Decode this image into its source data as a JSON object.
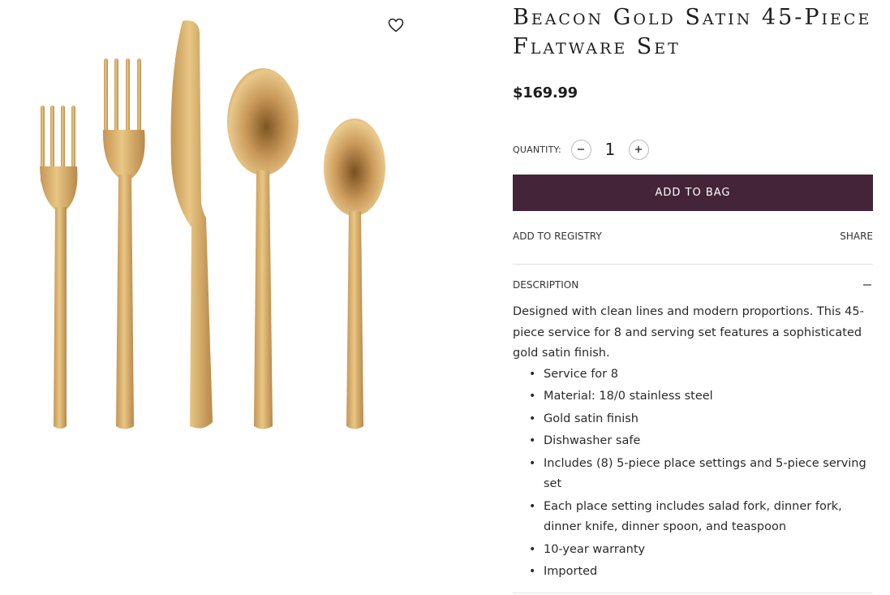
{
  "product": {
    "title": "Beacon Gold Satin 45-Piece Flatware Set",
    "price": "$169.99",
    "image_alt": "gold flatware set: salad fork, dinner fork, dinner knife, dinner spoon, teaspoon",
    "wishlist_icon": "heart-outline-icon",
    "colors": {
      "gold_light": "#e3c07c",
      "gold_mid": "#c9995a",
      "gold_dark": "#8e6630"
    }
  },
  "quantity": {
    "label": "QUANTITY:",
    "value": "1",
    "minus_icon": "minus-icon",
    "plus_icon": "plus-icon"
  },
  "actions": {
    "add_to_bag": "ADD TO BAG",
    "add_to_registry": "ADD TO REGISTRY",
    "share": "SHARE",
    "accent_color": "#432439"
  },
  "description": {
    "heading": "DESCRIPTION",
    "toggle_icon": "collapse-minus-icon",
    "text": "Designed with clean lines and modern proportions. This 45-piece service for 8 and serving set features a sophisticated gold satin finish.",
    "bullets": [
      "Service for 8",
      "Material: 18/0 stainless steel",
      "Gold satin finish",
      "Dishwasher safe",
      "Includes (8) 5-piece place settings and 5-piece serving set",
      "Each place setting includes salad fork, dinner fork, dinner knife, dinner spoon, and teaspoon",
      "10-year warranty",
      "Imported"
    ]
  }
}
